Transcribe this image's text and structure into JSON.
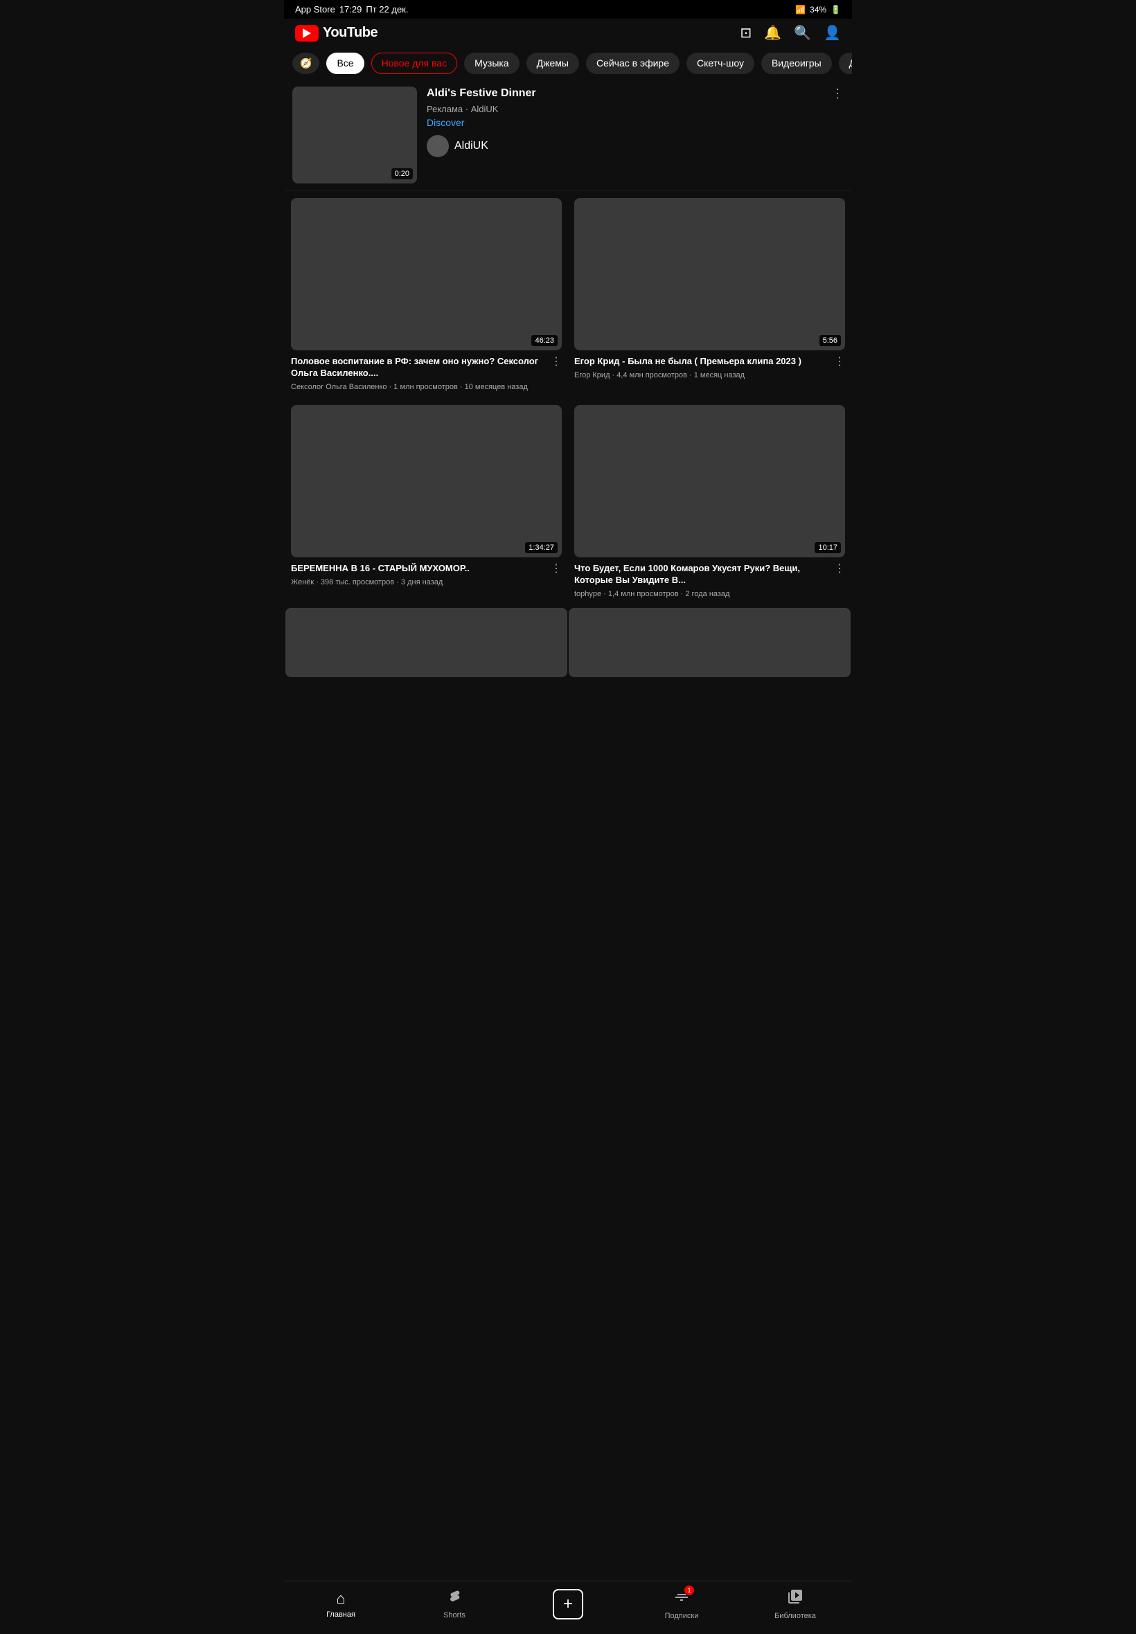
{
  "status": {
    "carrier": "App Store",
    "time": "17:29",
    "date": "Пт 22 дек.",
    "wifi": "wifi",
    "battery": "34%"
  },
  "header": {
    "logo_text": "YouTube"
  },
  "categories": [
    {
      "label": "🧭",
      "type": "explore"
    },
    {
      "label": "Все",
      "type": "active-plain"
    },
    {
      "label": "Новое для вас",
      "type": "active-outline"
    },
    {
      "label": "Музыка",
      "type": "normal"
    },
    {
      "label": "Джемы",
      "type": "normal"
    },
    {
      "label": "Сейчас в эфире",
      "type": "normal"
    },
    {
      "label": "Скетч-шоу",
      "type": "normal"
    },
    {
      "label": "Видеоигры",
      "type": "normal"
    },
    {
      "label": "Дома",
      "type": "normal"
    }
  ],
  "ad": {
    "title": "Aldi's Festive Dinner",
    "label": "Реклама · AldiUK",
    "discover": "Discover",
    "channel": "AldiUK",
    "duration": "0:20"
  },
  "videos": [
    {
      "title": "Половое воспитание в РФ: зачем оно нужно? Сексолог Ольга Василенко....",
      "channel": "Сексолог Ольга Василенко",
      "views": "1 млн просмотров",
      "ago": "10 месяцев назад",
      "duration": "46:23"
    },
    {
      "title": "Егор Крид - Была не была ( Премьера клипа 2023 )",
      "channel": "Егор Крид",
      "views": "4,4 млн просмотров",
      "ago": "1 месяц назад",
      "duration": "5:56"
    },
    {
      "title": "БЕРЕМЕННА В 16 - СТАРЫЙ МУХОМОР..",
      "channel": "Женёк",
      "views": "398 тыс. просмотров",
      "ago": "3 дня назад",
      "duration": "1:34:27"
    },
    {
      "title": "Что Будет, Если 1000 Комаров Укусят Руки? Вещи, Которые Вы Увидите В...",
      "channel": "tophype",
      "views": "1,4 млн просмотров",
      "ago": "2 года назад",
      "duration": "10:17"
    }
  ],
  "bottom_nav": [
    {
      "label": "Главная",
      "icon": "🏠",
      "active": true
    },
    {
      "label": "Shorts",
      "icon": "✂",
      "active": false
    },
    {
      "label": "+",
      "icon": "+",
      "active": false,
      "type": "add"
    },
    {
      "label": "Подписки",
      "icon": "📺",
      "active": false,
      "badge": "1"
    },
    {
      "label": "Библиотека",
      "icon": "📁",
      "active": false
    }
  ]
}
